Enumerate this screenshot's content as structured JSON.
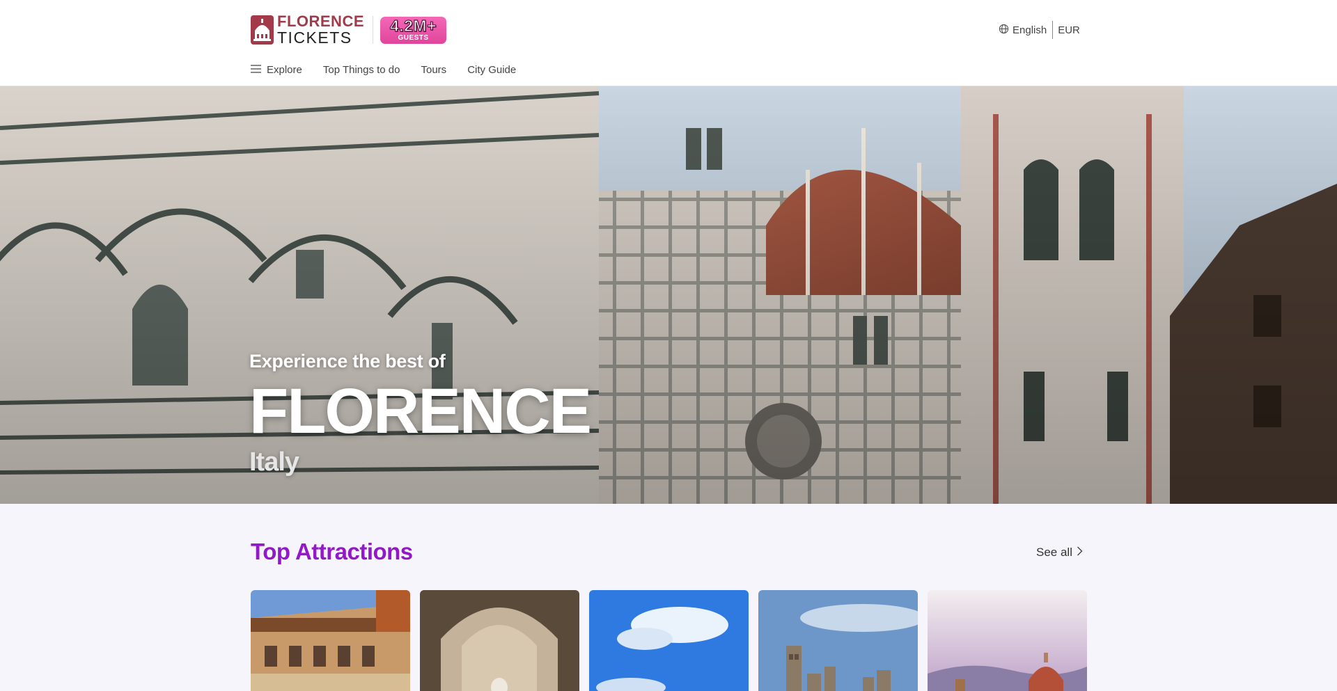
{
  "header": {
    "logo": {
      "line1": "FLORENCE",
      "line2": "TICKETS",
      "badge_number": "4.2M+",
      "badge_label": "GUESTS",
      "brand_color": "#a33a4a",
      "badge_color": "#ec57a9"
    },
    "language": "English",
    "currency": "EUR",
    "nav": [
      {
        "label": "Explore",
        "icon": "menu-icon"
      },
      {
        "label": "Top Things to do"
      },
      {
        "label": "Tours"
      },
      {
        "label": "City Guide"
      }
    ]
  },
  "hero": {
    "pretitle": "Experience the best of",
    "title": "FLORENCE",
    "subtitle": "Italy"
  },
  "attractions": {
    "title": "Top Attractions",
    "title_color": "#9318c8",
    "see_all": "See all",
    "cards": [
      {
        "image": "uffizi-gallery-photo"
      },
      {
        "image": "david-statue-photo"
      },
      {
        "image": "sky-landscape-photo"
      },
      {
        "image": "san-gimignano-towers-photo"
      },
      {
        "image": "florence-duomo-sunset-photo"
      }
    ]
  }
}
